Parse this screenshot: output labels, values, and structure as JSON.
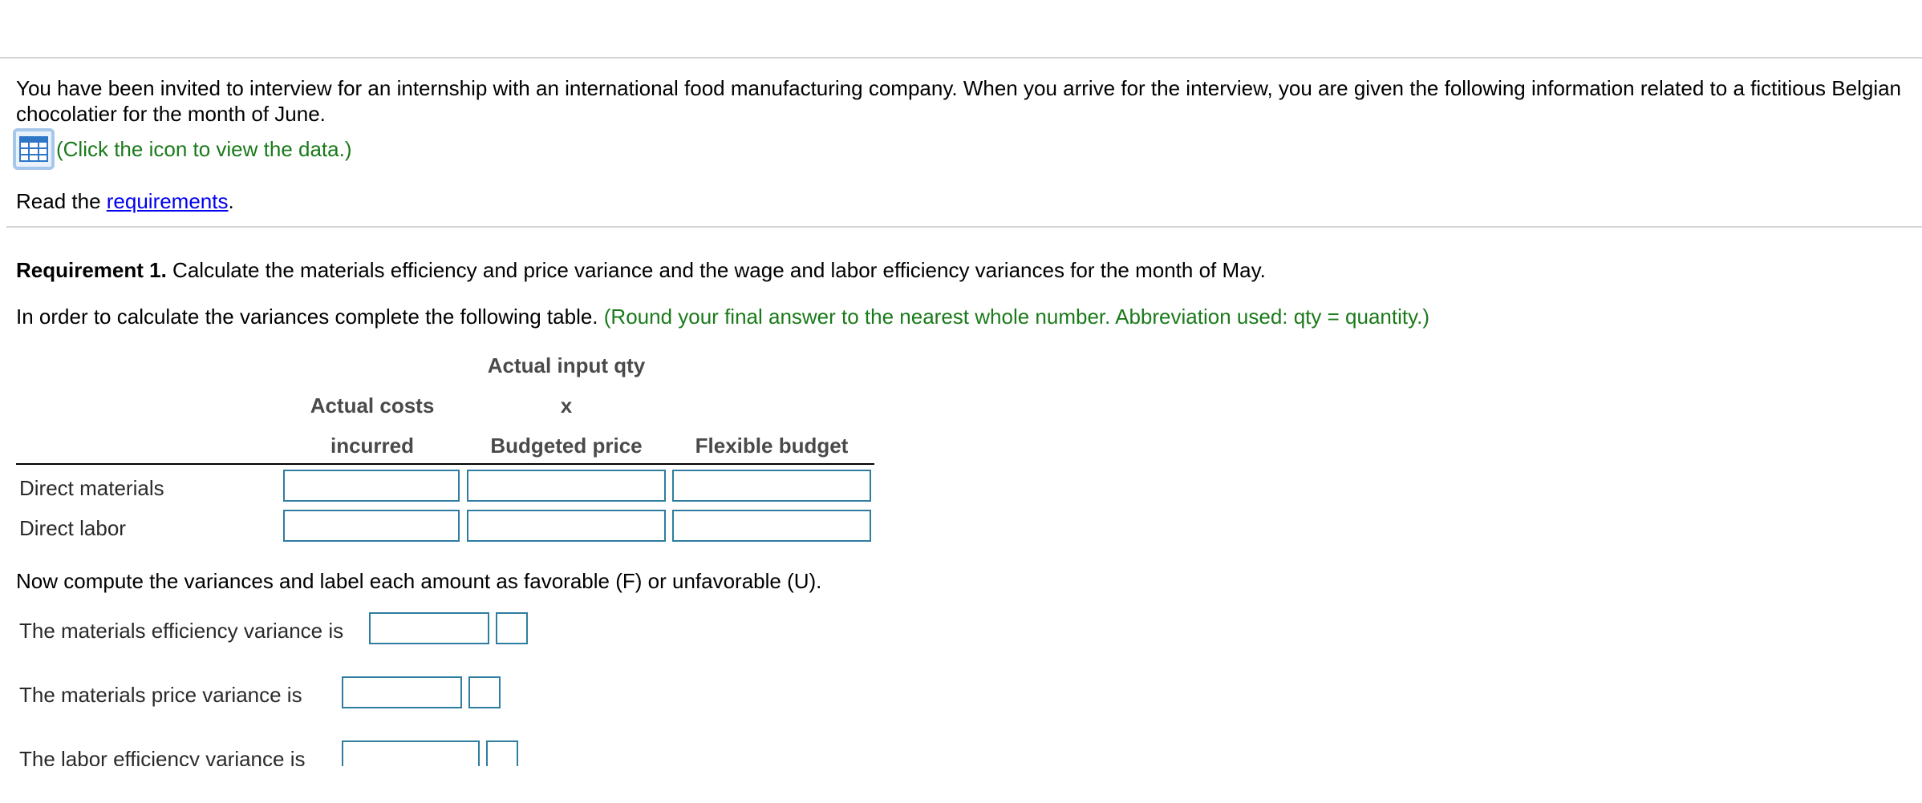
{
  "intro": {
    "text": "You have been invited to interview for an internship with an international food manufacturing company. When you arrive for the interview, you are given the following information related to a fictitious Belgian chocolatier for the month of June."
  },
  "data_link": {
    "icon": "table-grid-icon",
    "text": "(Click the icon to view the data.)"
  },
  "read": {
    "prefix": "Read the ",
    "link": "requirements",
    "suffix": "."
  },
  "requirement1": {
    "label": "Requirement 1.",
    "text": " Calculate the materials efficiency and price variance and the wage and labor efficiency variances for the month of May."
  },
  "instruction": {
    "text": "In order to calculate the variances complete the following table.",
    "hint": "(Round your final answer to the nearest whole number. Abbreviation used: qty = quantity.)"
  },
  "table": {
    "headers": {
      "actual_line1": "Actual costs",
      "actual_line2": "incurred",
      "input_line1": "Actual input qty",
      "input_line2": "x",
      "input_line3": "Budgeted price",
      "flexible": "Flexible budget"
    },
    "rows": [
      {
        "label": "Direct materials",
        "actual": "",
        "input": "",
        "flexible": ""
      },
      {
        "label": "Direct labor",
        "actual": "",
        "input": "",
        "flexible": ""
      }
    ]
  },
  "variances": {
    "intro": "Now compute the variances and label each amount as favorable (F) or unfavorable (U).",
    "items": [
      {
        "label": "The materials efficiency variance is",
        "amount": "",
        "fu": ""
      },
      {
        "label": "The materials price variance is",
        "amount": "",
        "fu": ""
      },
      {
        "label": "The labor efficiency variance is",
        "amount": "",
        "fu": ""
      }
    ]
  },
  "colors": {
    "link_blue": "#0000ee",
    "hint_green": "#1a7a1a",
    "input_border": "#2e7da0",
    "icon_blue": "#2f76c6"
  }
}
